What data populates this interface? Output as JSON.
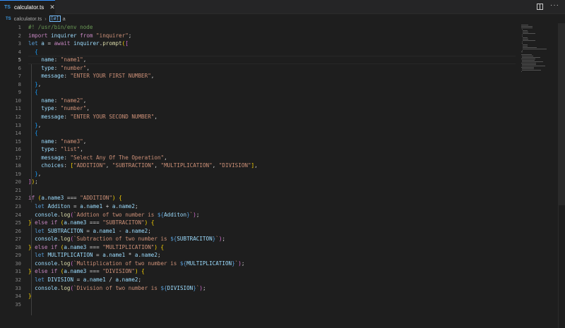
{
  "tab": {
    "badge": "TS",
    "filename": "calculator.ts",
    "close": "✕"
  },
  "actions": {
    "more": "···"
  },
  "breadcrumb": {
    "badge": "TS",
    "file": "calculator.ts",
    "separator": "›",
    "symbol_icon": "[ø]",
    "symbol": "a"
  },
  "editor": {
    "active_line": 5,
    "lines": [
      [
        [
          "cm",
          "#! /usr/bin/env node"
        ]
      ],
      [
        [
          "kw",
          "import"
        ],
        [
          "p",
          " "
        ],
        [
          "var",
          "inquirer"
        ],
        [
          "p",
          " "
        ],
        [
          "kw",
          "from"
        ],
        [
          "p",
          " "
        ],
        [
          "str",
          "\"inquirer\""
        ],
        [
          "p",
          ";"
        ]
      ],
      [
        [
          "decl",
          "let"
        ],
        [
          "p",
          " "
        ],
        [
          "var",
          "a"
        ],
        [
          "p",
          " = "
        ],
        [
          "kw",
          "await"
        ],
        [
          "p",
          " "
        ],
        [
          "var",
          "inquirer"
        ],
        [
          "p",
          "."
        ],
        [
          "fn",
          "prompt"
        ],
        [
          "b1",
          "("
        ],
        [
          "b2",
          "["
        ]
      ],
      [
        [
          "p",
          "  "
        ],
        [
          "b3",
          "{"
        ]
      ],
      [
        [
          "p",
          "    "
        ],
        [
          "var",
          "name"
        ],
        [
          "p",
          ": "
        ],
        [
          "str",
          "\"name1\""
        ],
        [
          "p",
          ","
        ]
      ],
      [
        [
          "p",
          "    "
        ],
        [
          "var",
          "type"
        ],
        [
          "p",
          ": "
        ],
        [
          "str",
          "\"number\""
        ],
        [
          "p",
          ","
        ]
      ],
      [
        [
          "p",
          "    "
        ],
        [
          "var",
          "message"
        ],
        [
          "p",
          ": "
        ],
        [
          "str",
          "\"ENTER YOUR FIRST NUMBER\""
        ],
        [
          "p",
          ","
        ]
      ],
      [
        [
          "p",
          "  "
        ],
        [
          "b3",
          "}"
        ],
        [
          "p",
          ","
        ]
      ],
      [
        [
          "p",
          "  "
        ],
        [
          "b3",
          "{"
        ]
      ],
      [
        [
          "p",
          "    "
        ],
        [
          "var",
          "name"
        ],
        [
          "p",
          ": "
        ],
        [
          "str",
          "\"name2\""
        ],
        [
          "p",
          ","
        ]
      ],
      [
        [
          "p",
          "    "
        ],
        [
          "var",
          "type"
        ],
        [
          "p",
          ": "
        ],
        [
          "str",
          "\"number\""
        ],
        [
          "p",
          ","
        ]
      ],
      [
        [
          "p",
          "    "
        ],
        [
          "var",
          "message"
        ],
        [
          "p",
          ": "
        ],
        [
          "str",
          "\"ENTER YOUR SECOND NUMBER\""
        ],
        [
          "p",
          ","
        ]
      ],
      [
        [
          "p",
          "  "
        ],
        [
          "b3",
          "}"
        ],
        [
          "p",
          ","
        ]
      ],
      [
        [
          "p",
          "  "
        ],
        [
          "b3",
          "{"
        ]
      ],
      [
        [
          "p",
          "    "
        ],
        [
          "var",
          "name"
        ],
        [
          "p",
          ": "
        ],
        [
          "str",
          "\"name3\""
        ],
        [
          "p",
          ","
        ]
      ],
      [
        [
          "p",
          "    "
        ],
        [
          "var",
          "type"
        ],
        [
          "p",
          ": "
        ],
        [
          "str",
          "\"list\""
        ],
        [
          "p",
          ","
        ]
      ],
      [
        [
          "p",
          "    "
        ],
        [
          "var",
          "message"
        ],
        [
          "p",
          ": "
        ],
        [
          "str",
          "\"Select Any Of The Operation\""
        ],
        [
          "p",
          ","
        ]
      ],
      [
        [
          "p",
          "    "
        ],
        [
          "var",
          "choices"
        ],
        [
          "p",
          ": "
        ],
        [
          "b1",
          "["
        ],
        [
          "str",
          "\"ADDITION\""
        ],
        [
          "p",
          ", "
        ],
        [
          "str",
          "\"SUBTRACTION\""
        ],
        [
          "p",
          ", "
        ],
        [
          "str",
          "\"MULTIPLICATION\""
        ],
        [
          "p",
          ", "
        ],
        [
          "str",
          "\"DIVISION\""
        ],
        [
          "b1",
          "]"
        ],
        [
          "p",
          ","
        ]
      ],
      [
        [
          "p",
          "  "
        ],
        [
          "b3",
          "}"
        ],
        [
          "p",
          ","
        ]
      ],
      [
        [
          "b2",
          "]"
        ],
        [
          "b1",
          ")"
        ],
        [
          "p",
          ";"
        ]
      ],
      [],
      [
        [
          "kw",
          "if"
        ],
        [
          "p",
          " "
        ],
        [
          "b1",
          "("
        ],
        [
          "var",
          "a"
        ],
        [
          "p",
          "."
        ],
        [
          "var",
          "name3"
        ],
        [
          "p",
          " === "
        ],
        [
          "str",
          "\"ADDITION\""
        ],
        [
          "b1",
          ")"
        ],
        [
          "p",
          " "
        ],
        [
          "b1",
          "{"
        ]
      ],
      [
        [
          "p",
          "  "
        ],
        [
          "decl",
          "let"
        ],
        [
          "p",
          " "
        ],
        [
          "var",
          "Additon"
        ],
        [
          "p",
          " = "
        ],
        [
          "var",
          "a"
        ],
        [
          "p",
          "."
        ],
        [
          "var",
          "name1"
        ],
        [
          "p",
          " + "
        ],
        [
          "var",
          "a"
        ],
        [
          "p",
          "."
        ],
        [
          "var",
          "name2"
        ],
        [
          "p",
          ";"
        ]
      ],
      [
        [
          "p",
          "  "
        ],
        [
          "var",
          "console"
        ],
        [
          "p",
          "."
        ],
        [
          "fn",
          "log"
        ],
        [
          "b2",
          "("
        ],
        [
          "str",
          "`Addtion of two number is "
        ],
        [
          "tpl",
          "${"
        ],
        [
          "var",
          "Additon"
        ],
        [
          "tpl",
          "}"
        ],
        [
          "str",
          "`"
        ],
        [
          "b2",
          ")"
        ],
        [
          "p",
          ";"
        ]
      ],
      [
        [
          "b1",
          "}"
        ],
        [
          "p",
          " "
        ],
        [
          "kw",
          "else"
        ],
        [
          "p",
          " "
        ],
        [
          "kw",
          "if"
        ],
        [
          "p",
          " "
        ],
        [
          "b1",
          "("
        ],
        [
          "var",
          "a"
        ],
        [
          "p",
          "."
        ],
        [
          "var",
          "name3"
        ],
        [
          "p",
          " === "
        ],
        [
          "str",
          "\"SUBTRACITON\""
        ],
        [
          "b1",
          ")"
        ],
        [
          "p",
          " "
        ],
        [
          "b1",
          "{"
        ]
      ],
      [
        [
          "p",
          "  "
        ],
        [
          "decl",
          "let"
        ],
        [
          "p",
          " "
        ],
        [
          "var",
          "SUBTRACITON"
        ],
        [
          "p",
          " = "
        ],
        [
          "var",
          "a"
        ],
        [
          "p",
          "."
        ],
        [
          "var",
          "name1"
        ],
        [
          "p",
          " - "
        ],
        [
          "var",
          "a"
        ],
        [
          "p",
          "."
        ],
        [
          "var",
          "name2"
        ],
        [
          "p",
          ";"
        ]
      ],
      [
        [
          "p",
          "  "
        ],
        [
          "var",
          "console"
        ],
        [
          "p",
          "."
        ],
        [
          "fn",
          "log"
        ],
        [
          "b2",
          "("
        ],
        [
          "str",
          "`Subtraction of two number is "
        ],
        [
          "tpl",
          "${"
        ],
        [
          "var",
          "SUBTRACITON"
        ],
        [
          "tpl",
          "}"
        ],
        [
          "str",
          "`"
        ],
        [
          "b2",
          ")"
        ],
        [
          "p",
          ";"
        ]
      ],
      [
        [
          "b1",
          "}"
        ],
        [
          "p",
          " "
        ],
        [
          "kw",
          "else"
        ],
        [
          "p",
          " "
        ],
        [
          "kw",
          "if"
        ],
        [
          "p",
          " "
        ],
        [
          "b1",
          "("
        ],
        [
          "var",
          "a"
        ],
        [
          "p",
          "."
        ],
        [
          "var",
          "name3"
        ],
        [
          "p",
          " === "
        ],
        [
          "str",
          "\"MULTIPLICATION\""
        ],
        [
          "b1",
          ")"
        ],
        [
          "p",
          " "
        ],
        [
          "b1",
          "{"
        ]
      ],
      [
        [
          "p",
          "  "
        ],
        [
          "decl",
          "let"
        ],
        [
          "p",
          " "
        ],
        [
          "var",
          "MULTIPLICATION"
        ],
        [
          "p",
          " = "
        ],
        [
          "var",
          "a"
        ],
        [
          "p",
          "."
        ],
        [
          "var",
          "name1"
        ],
        [
          "p",
          " * "
        ],
        [
          "var",
          "a"
        ],
        [
          "p",
          "."
        ],
        [
          "var",
          "name2"
        ],
        [
          "p",
          ";"
        ]
      ],
      [
        [
          "p",
          "  "
        ],
        [
          "var",
          "console"
        ],
        [
          "p",
          "."
        ],
        [
          "fn",
          "log"
        ],
        [
          "b2",
          "("
        ],
        [
          "str",
          "`Multiplication of two number is "
        ],
        [
          "tpl",
          "${"
        ],
        [
          "var",
          "MULTIPLICATION"
        ],
        [
          "tpl",
          "}"
        ],
        [
          "str",
          "`"
        ],
        [
          "b2",
          ")"
        ],
        [
          "p",
          ";"
        ]
      ],
      [
        [
          "b1",
          "}"
        ],
        [
          "p",
          " "
        ],
        [
          "kw",
          "else"
        ],
        [
          "p",
          " "
        ],
        [
          "kw",
          "if"
        ],
        [
          "p",
          " "
        ],
        [
          "b1",
          "("
        ],
        [
          "var",
          "a"
        ],
        [
          "p",
          "."
        ],
        [
          "var",
          "name3"
        ],
        [
          "p",
          " === "
        ],
        [
          "str",
          "\"DIVISION\""
        ],
        [
          "b1",
          ")"
        ],
        [
          "p",
          " "
        ],
        [
          "b1",
          "{"
        ]
      ],
      [
        [
          "p",
          "  "
        ],
        [
          "decl",
          "let"
        ],
        [
          "p",
          " "
        ],
        [
          "var",
          "DIVISION"
        ],
        [
          "p",
          " = "
        ],
        [
          "var",
          "a"
        ],
        [
          "p",
          "."
        ],
        [
          "var",
          "name1"
        ],
        [
          "p",
          " / "
        ],
        [
          "var",
          "a"
        ],
        [
          "p",
          "."
        ],
        [
          "var",
          "name2"
        ],
        [
          "p",
          ";"
        ]
      ],
      [
        [
          "p",
          "  "
        ],
        [
          "var",
          "console"
        ],
        [
          "p",
          "."
        ],
        [
          "fn",
          "log"
        ],
        [
          "b2",
          "("
        ],
        [
          "str",
          "`Division of two number is "
        ],
        [
          "tpl",
          "${"
        ],
        [
          "var",
          "DIVISION"
        ],
        [
          "tpl",
          "}"
        ],
        [
          "str",
          "`"
        ],
        [
          "b2",
          ")"
        ],
        [
          "p",
          ";"
        ]
      ],
      [
        [
          "b1",
          "}"
        ]
      ],
      []
    ]
  }
}
